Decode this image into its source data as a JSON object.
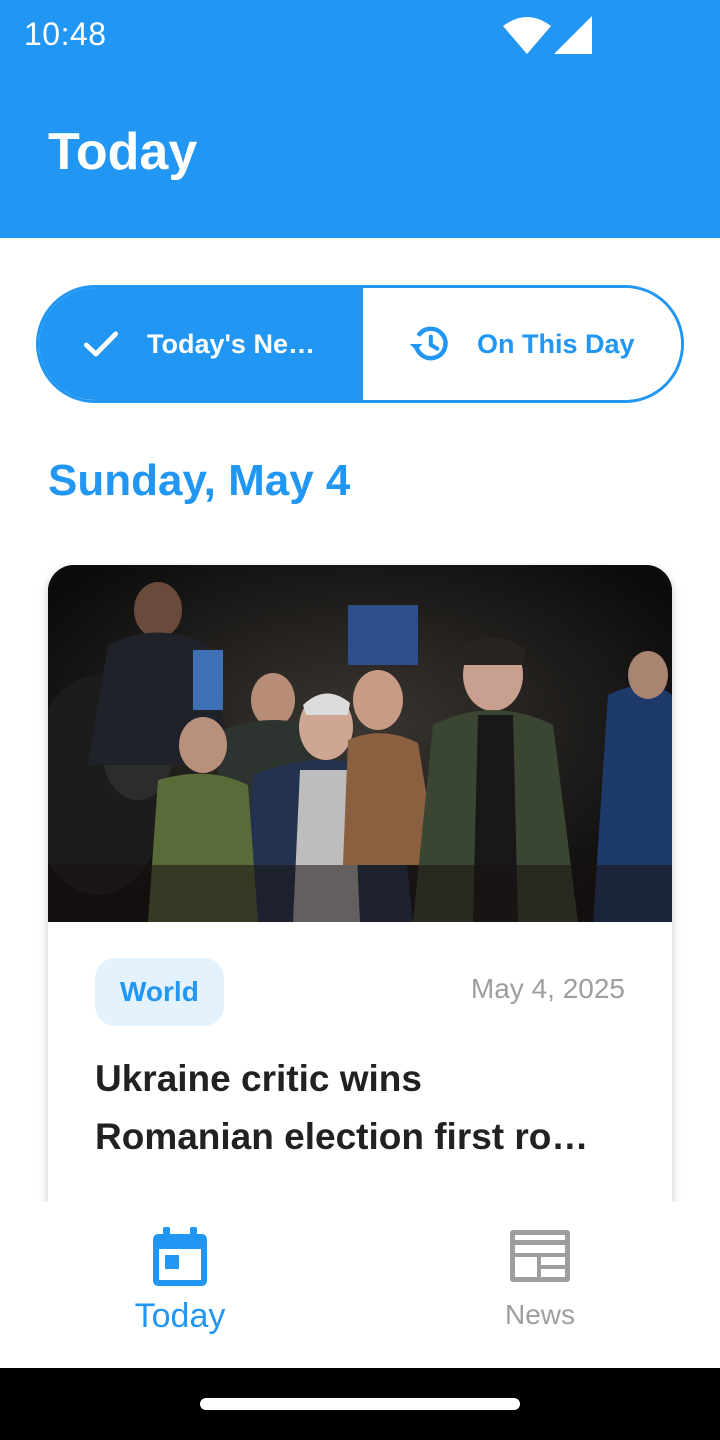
{
  "status_bar": {
    "time": "10:48"
  },
  "app_bar": {
    "title": "Today"
  },
  "segmented": {
    "items": [
      {
        "label": "Today's Ne…",
        "icon": "check-icon",
        "selected": true
      },
      {
        "label": "On This Day",
        "icon": "history-icon",
        "selected": false
      }
    ]
  },
  "date_heading": "Sunday, May 4",
  "card": {
    "category": "World",
    "date": "May 4, 2025",
    "headline_line1": "Ukraine critic wins",
    "headline_line2": "Romanian election first ro…"
  },
  "bottom_nav": {
    "items": [
      {
        "label": "Today",
        "icon": "calendar-icon",
        "selected": true
      },
      {
        "label": "News",
        "icon": "newspaper-icon",
        "selected": false
      }
    ]
  },
  "colors": {
    "primary": "#2196f3",
    "chip_bg": "#e3f2fd",
    "muted": "#9e9e9e",
    "text": "#212121"
  }
}
